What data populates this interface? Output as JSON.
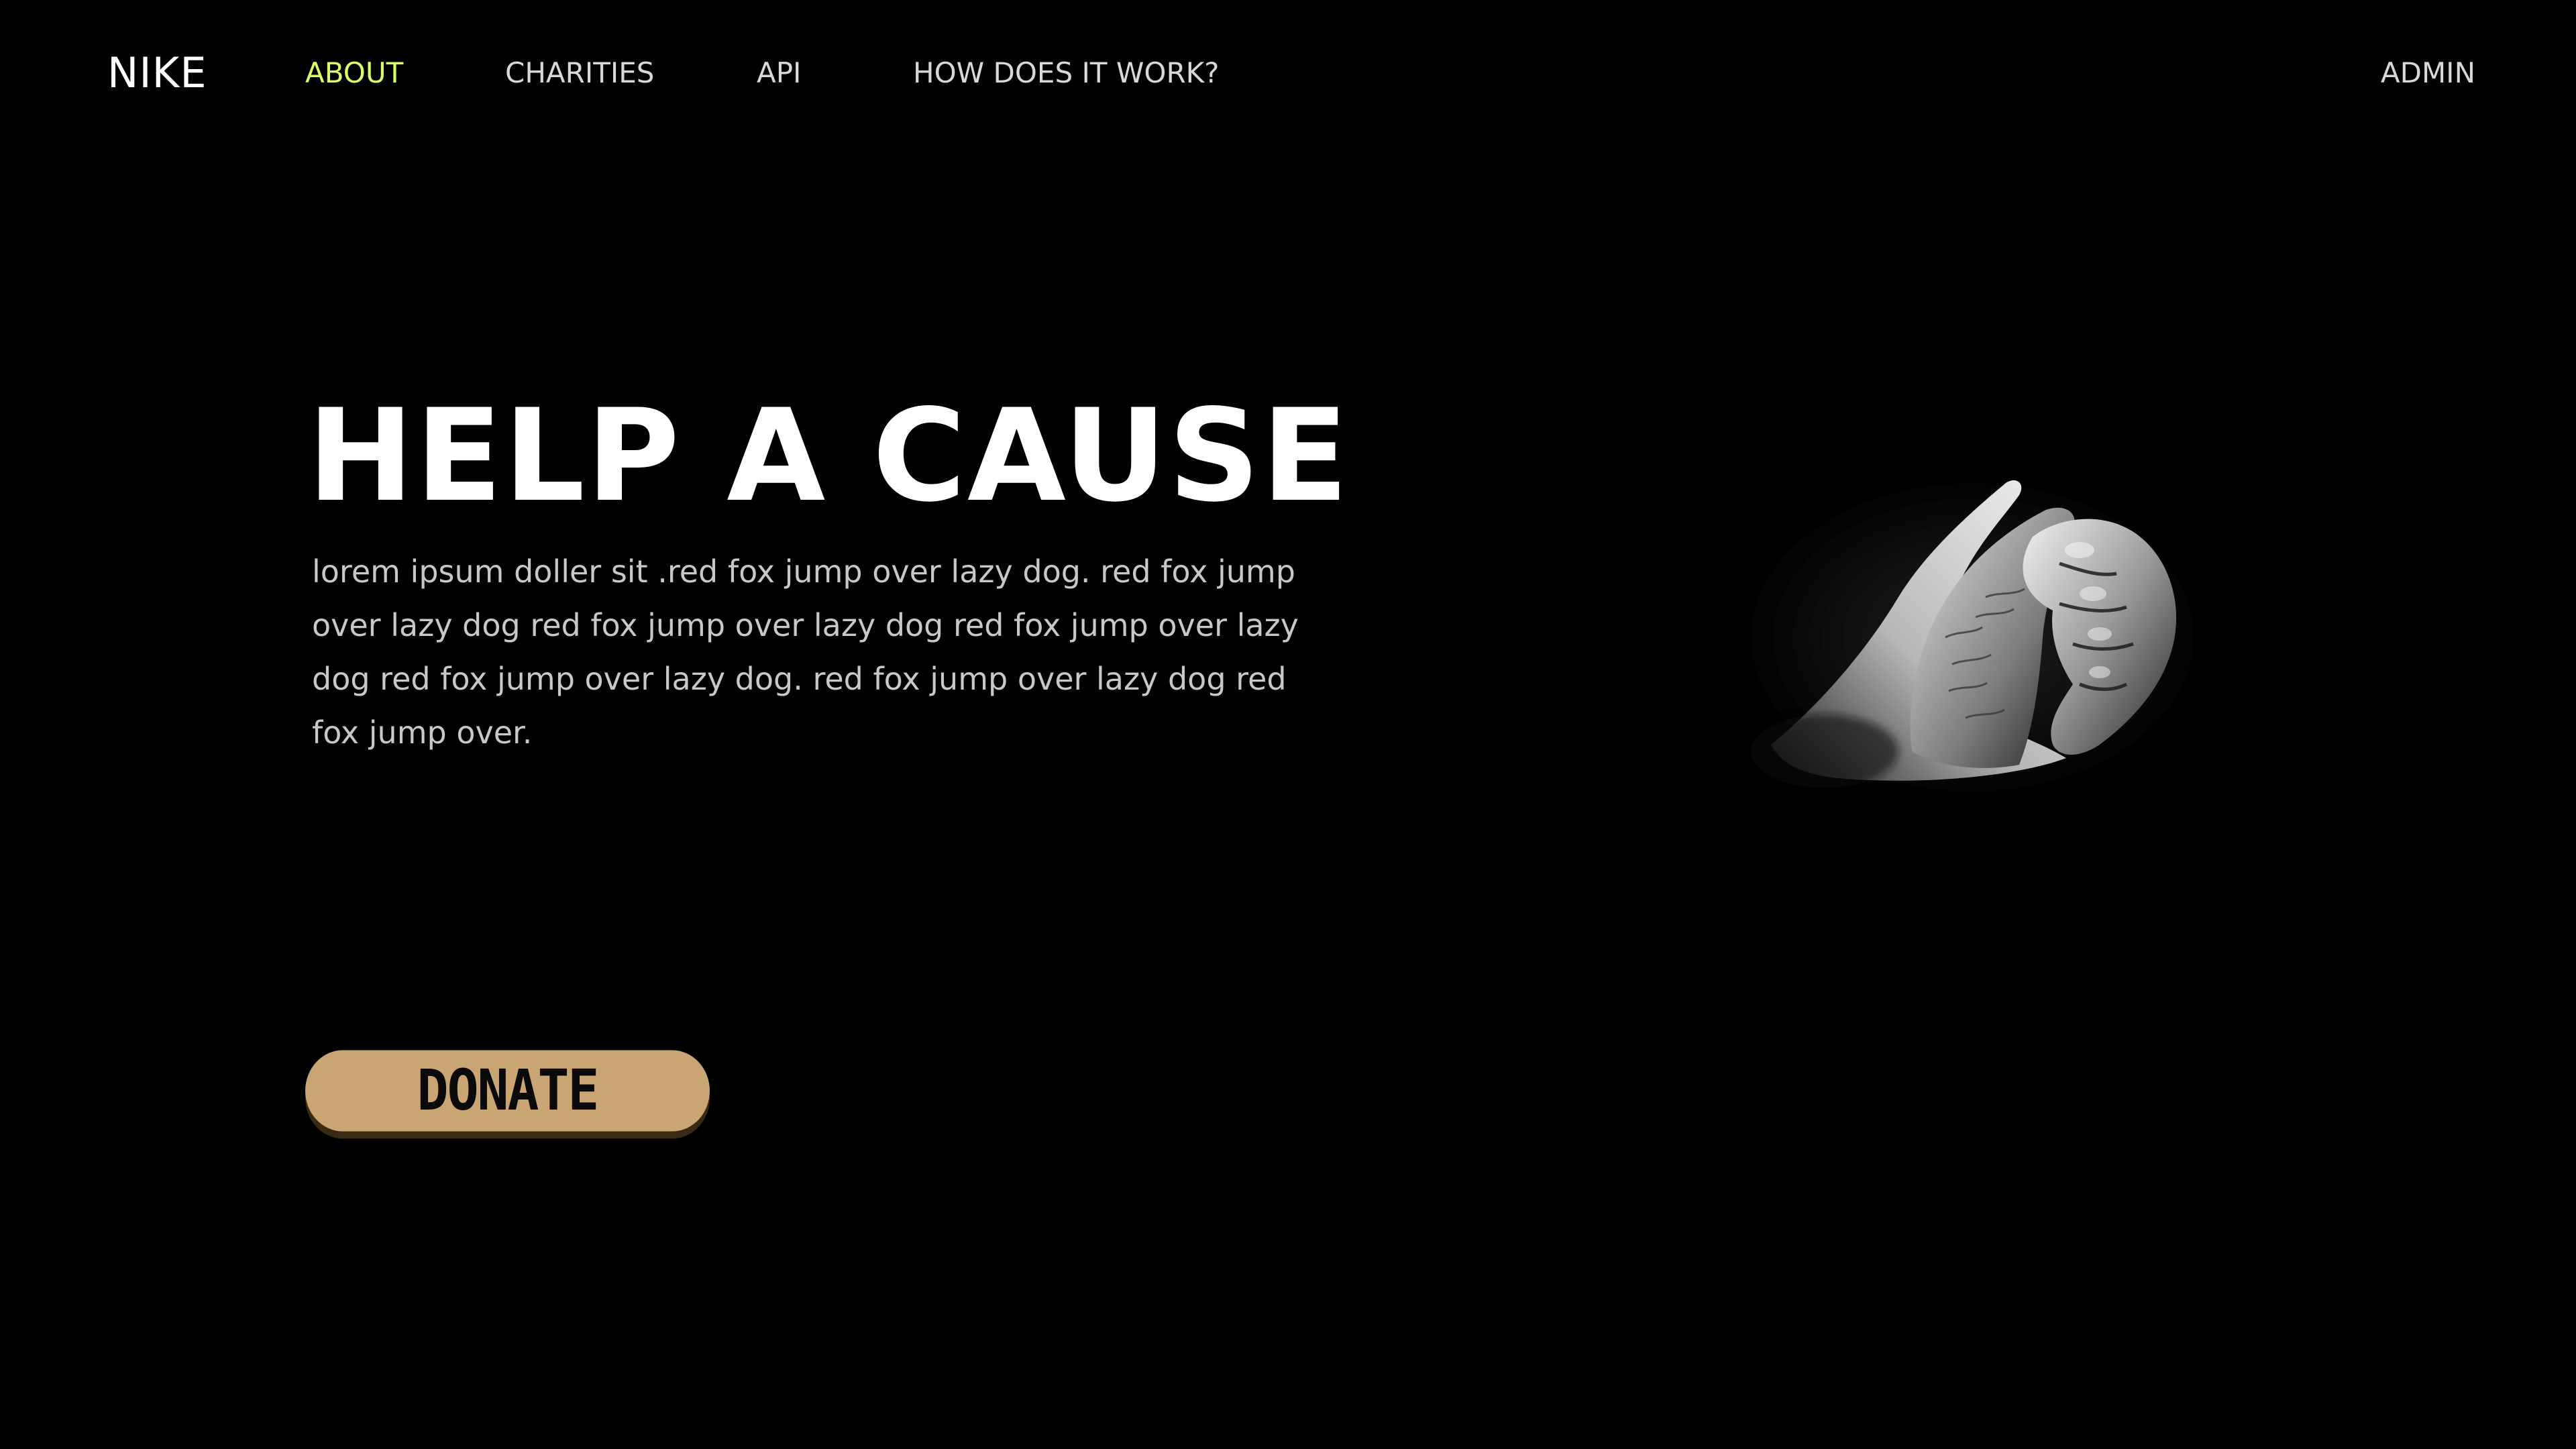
{
  "nav": {
    "brand": "NIKE",
    "links": [
      {
        "label": "ABOUT",
        "active": true
      },
      {
        "label": "CHARITIES",
        "active": false
      },
      {
        "label": "API",
        "active": false
      },
      {
        "label": "HOW DOES IT WORK?",
        "active": false
      }
    ],
    "admin": "ADMIN",
    "active_color": "#d8ff6a"
  },
  "hero": {
    "title": "HELP A CAUSE",
    "body": "lorem ipsum doller sit .red fox jump over lazy dog. red fox jump over lazy dog red fox jump over lazy dog red fox jump over lazy dog red fox jump over lazy dog. red fox jump over lazy dog red fox jump over.",
    "donate_label": "DONATE",
    "donate_color": "#c9a574"
  },
  "image": {
    "icon": "holding-hands-icon"
  }
}
